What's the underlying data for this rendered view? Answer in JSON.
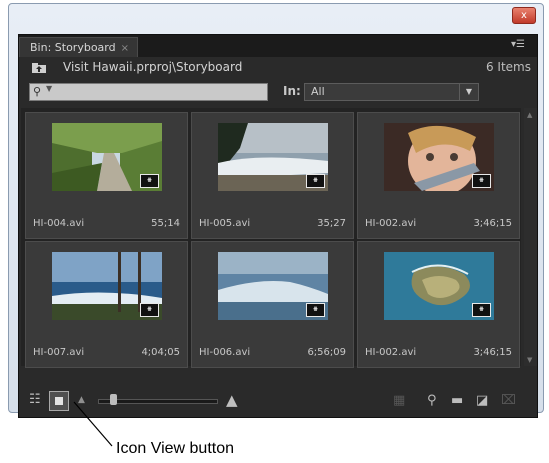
{
  "window": {
    "close_label": "x"
  },
  "panel": {
    "tab_title": "Bin: Storyboard",
    "tab_close": "×",
    "menu_icon": "panel-menu-icon",
    "path": "Visit Hawaii.prproj\\Storyboard",
    "item_count": "6 Items",
    "search": {
      "value": "",
      "icon": "search-icon"
    },
    "in_label": "In:",
    "in_value": "All"
  },
  "clips": [
    {
      "name": "HI-004.avi",
      "duration": "55;14"
    },
    {
      "name": "HI-005.avi",
      "duration": "35;27"
    },
    {
      "name": "HI-002.avi",
      "duration": "3;46;15"
    },
    {
      "name": "HI-007.avi",
      "duration": "4;04;05"
    },
    {
      "name": "HI-006.avi",
      "duration": "6;56;09"
    },
    {
      "name": "HI-002.avi",
      "duration": "3;46;15"
    }
  ],
  "toolbar": {
    "list_view": "list-view-icon",
    "icon_view": "icon-view-icon",
    "zoom_slider_value": 0.1,
    "find": "find-icon",
    "new_bin": "new-bin-icon",
    "new_item": "new-item-icon",
    "clear": "clear-icon"
  },
  "callout": {
    "label": "Icon View button"
  }
}
